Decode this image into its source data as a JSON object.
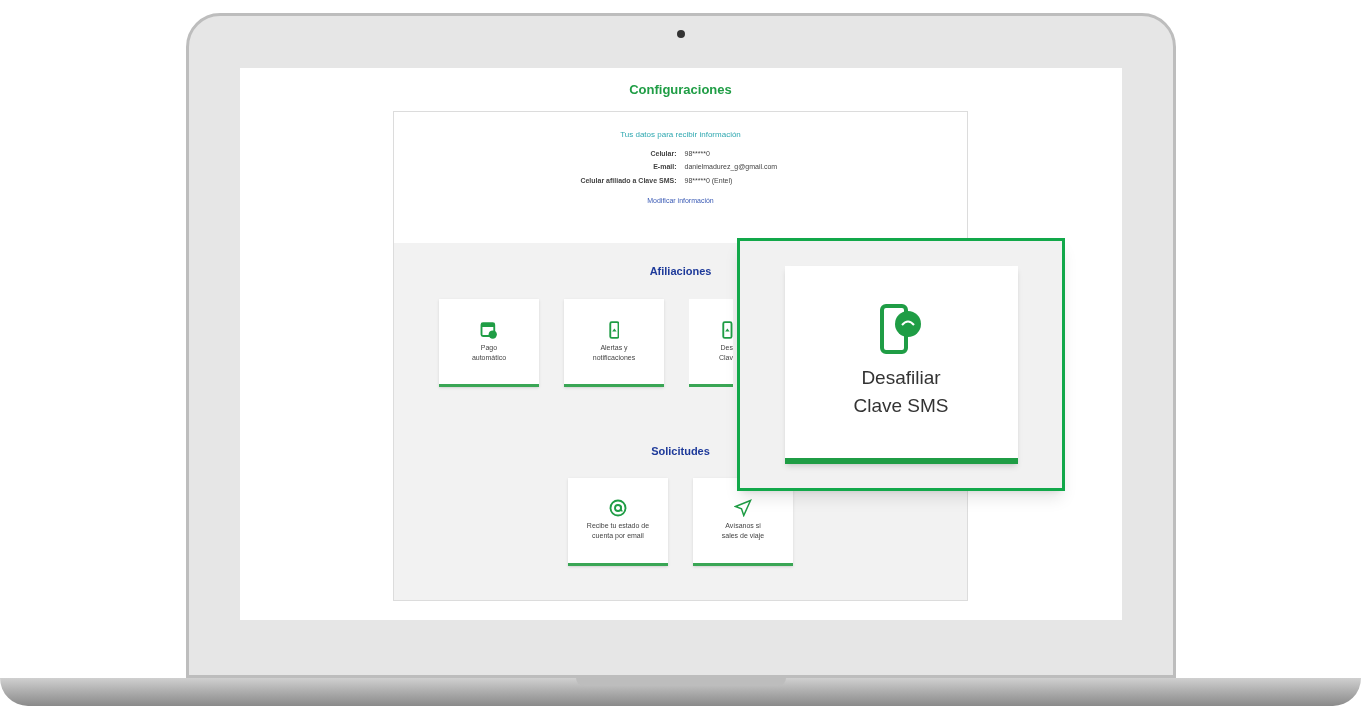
{
  "page": {
    "title": "Configuraciones",
    "info": {
      "heading": "Tus datos para recibir información",
      "rows": [
        {
          "label": "Celular:",
          "value": "98*****0"
        },
        {
          "label": "E-mail:",
          "value": "danielmadurez_g@gmail.com"
        },
        {
          "label": "Celular afiliado a Clave SMS:",
          "value": "98*****0 (Entel)"
        }
      ],
      "link": "Modificar información"
    },
    "sections": [
      {
        "title": "Afiliaciones",
        "tiles": [
          {
            "kind": "calendar",
            "clipped": false,
            "lines": [
              "Pago",
              "automático"
            ]
          },
          {
            "kind": "phone",
            "clipped": false,
            "lines": [
              "Alertas y",
              "notificaciones"
            ]
          },
          {
            "kind": "phone",
            "clipped": true,
            "lines": [
              "Des",
              "Clav"
            ]
          }
        ]
      },
      {
        "title": "Solicitudes",
        "tiles": [
          {
            "kind": "at",
            "clipped": false,
            "lines": [
              "Recibe tu estado de",
              "cuenta por email"
            ]
          },
          {
            "kind": "plane",
            "clipped": false,
            "lines": [
              "Avísanos si",
              "sales de viaje"
            ]
          }
        ]
      }
    ]
  },
  "callout": {
    "lines": [
      "Desafiliar",
      "Clave SMS"
    ]
  }
}
